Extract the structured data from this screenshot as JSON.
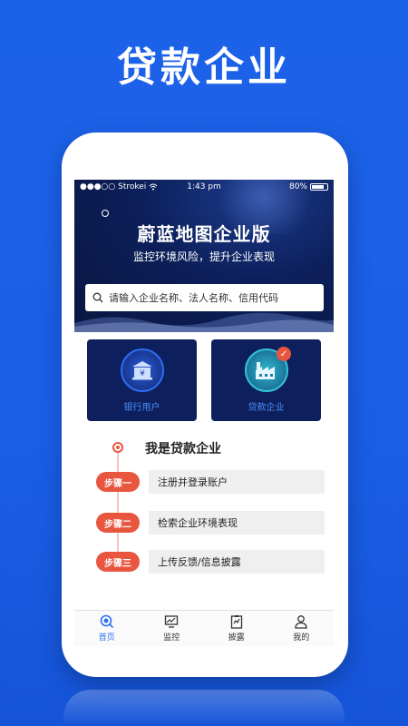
{
  "headline": "贷款企业",
  "status": {
    "carrier": "●●●○○ Strokei",
    "time": "1:43 pm",
    "battery": "80%"
  },
  "hero": {
    "title": "蔚蓝地图企业版",
    "subtitle": "监控环境风险，提升企业表现"
  },
  "search": {
    "placeholder": "请输入企业名称、法人名称、信用代码"
  },
  "cards": [
    {
      "label": "银行用户",
      "icon": "bank-icon",
      "checked": false
    },
    {
      "label": "贷款企业",
      "icon": "factory-icon",
      "checked": true
    }
  ],
  "steps_title": "我是贷款企业",
  "steps": [
    {
      "pill": "步骤一",
      "text": "注册并登录账户"
    },
    {
      "pill": "步骤二",
      "text": "检索企业环境表现"
    },
    {
      "pill": "步骤三",
      "text": "上传反馈/信息披露"
    }
  ],
  "tabs": [
    {
      "label": "首页",
      "icon": "home-search-icon",
      "active": true
    },
    {
      "label": "监控",
      "icon": "monitor-icon",
      "active": false
    },
    {
      "label": "披露",
      "icon": "clipboard-icon",
      "active": false
    },
    {
      "label": "我的",
      "icon": "user-icon",
      "active": false
    }
  ],
  "colors": {
    "background": "#1c62e8",
    "hero": "#0c1f5a",
    "accent_red": "#e8563f",
    "accent_blue": "#2a6ff0"
  }
}
